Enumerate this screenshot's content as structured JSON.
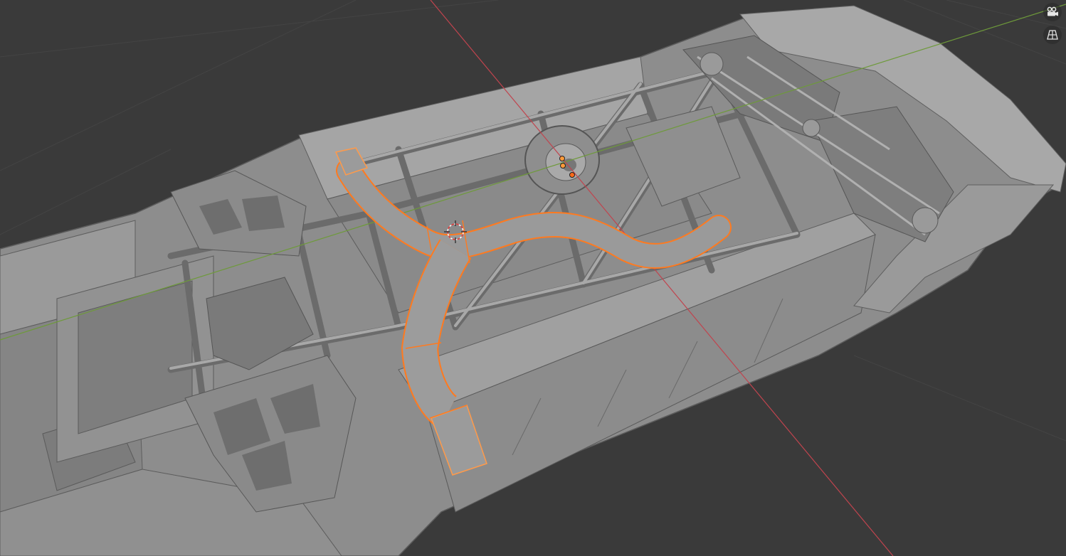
{
  "app": {
    "name": "3D viewport"
  },
  "viewport": {
    "background_color": "#3a3a3a",
    "grid_color": "#444444",
    "x_axis_color": "#c0444e",
    "y_axis_color": "#6e9a3a",
    "selection_outline_color": "#ff7a1f",
    "mesh_color": "#8a8a8a"
  },
  "overlay_buttons": [
    {
      "icon": "camera-icon",
      "tooltip": ""
    },
    {
      "icon": "perspective-grid-icon",
      "tooltip": ""
    }
  ],
  "scene": {
    "selected_object": "exhaust-pipe",
    "has_3d_cursor": true,
    "has_origin_points": true
  }
}
